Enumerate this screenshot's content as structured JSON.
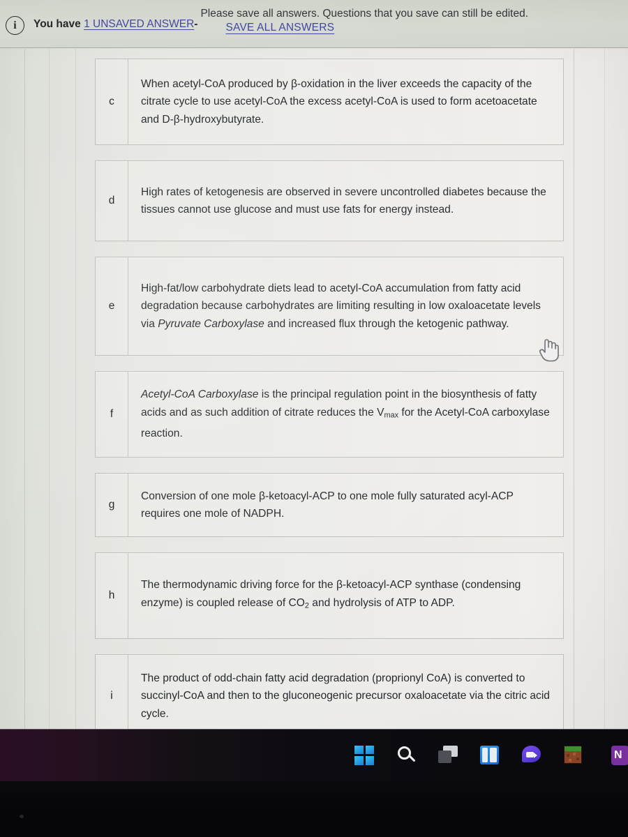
{
  "banner": {
    "icon": "info-circle-icon",
    "prefix": "You have",
    "unsaved_link": "1 UNSAVED ANSWER",
    "separator": "-",
    "message": "Please save all answers. Questions that you save can still be edited.",
    "save_all_label": "SAVE ALL ANSWERS",
    "link_color": "#3b3f9e",
    "background": "#d9ddd4"
  },
  "answers": [
    {
      "letter": "c",
      "text": "When acetyl-CoA produced by β-oxidation in the liver exceeds the capacity of the citrate cycle to use acetyl-CoA the excess acetyl-CoA is used to form acetoacetate and D-β-hydroxybutyrate."
    },
    {
      "letter": "d",
      "text": "High rates of ketogenesis are observed in severe uncontrolled diabetes because the tissues cannot use glucose and must use fats for energy instead."
    },
    {
      "letter": "e",
      "text_part1": "High-fat/low carbohydrate diets lead to acetyl-CoA accumulation from fatty acid degradation because carbohydrates are limiting resulting in low oxaloacetate levels via ",
      "italic": "Pyruvate Carboxylase",
      "text_part2": " and increased flux through the ketogenic pathway."
    },
    {
      "letter": "f",
      "italic": "Acetyl-CoA Carboxylase",
      "text_part1": " is the principal regulation point in the biosynthesis of fatty acids and as such addition of citrate reduces the ",
      "v_symbol": "V",
      "v_sub": "max",
      "text_part2": " for the Acetyl-CoA carboxylase reaction."
    },
    {
      "letter": "g",
      "text": "Conversion of one mole β-ketoacyl-ACP to one mole fully saturated acyl-ACP requires one mole of NADPH."
    },
    {
      "letter": "h",
      "text_part1": "The thermodynamic driving force for the β-ketoacyl-ACP synthase (condensing enzyme) is coupled release of CO",
      "sub": "2",
      "text_part2": " and hydrolysis of ATP to ADP."
    },
    {
      "letter": "i",
      "text": "The product of odd-chain fatty acid degradation (proprionyl CoA) is converted to succinyl-CoA and then to the gluconeogenic precursor oxaloacetate via the citric acid cycle."
    }
  ],
  "cursor": {
    "type": "pointer-hand-cursor"
  },
  "taskbar": {
    "items": [
      {
        "name": "windows-start-icon",
        "label": ""
      },
      {
        "name": "search-icon",
        "label": ""
      },
      {
        "name": "task-view-icon",
        "label": ""
      },
      {
        "name": "widgets-icon",
        "label": ""
      },
      {
        "name": "chat-icon",
        "label": ""
      },
      {
        "name": "minecraft-icon",
        "label": ""
      },
      {
        "name": "onenote-icon",
        "label": "N"
      }
    ]
  }
}
